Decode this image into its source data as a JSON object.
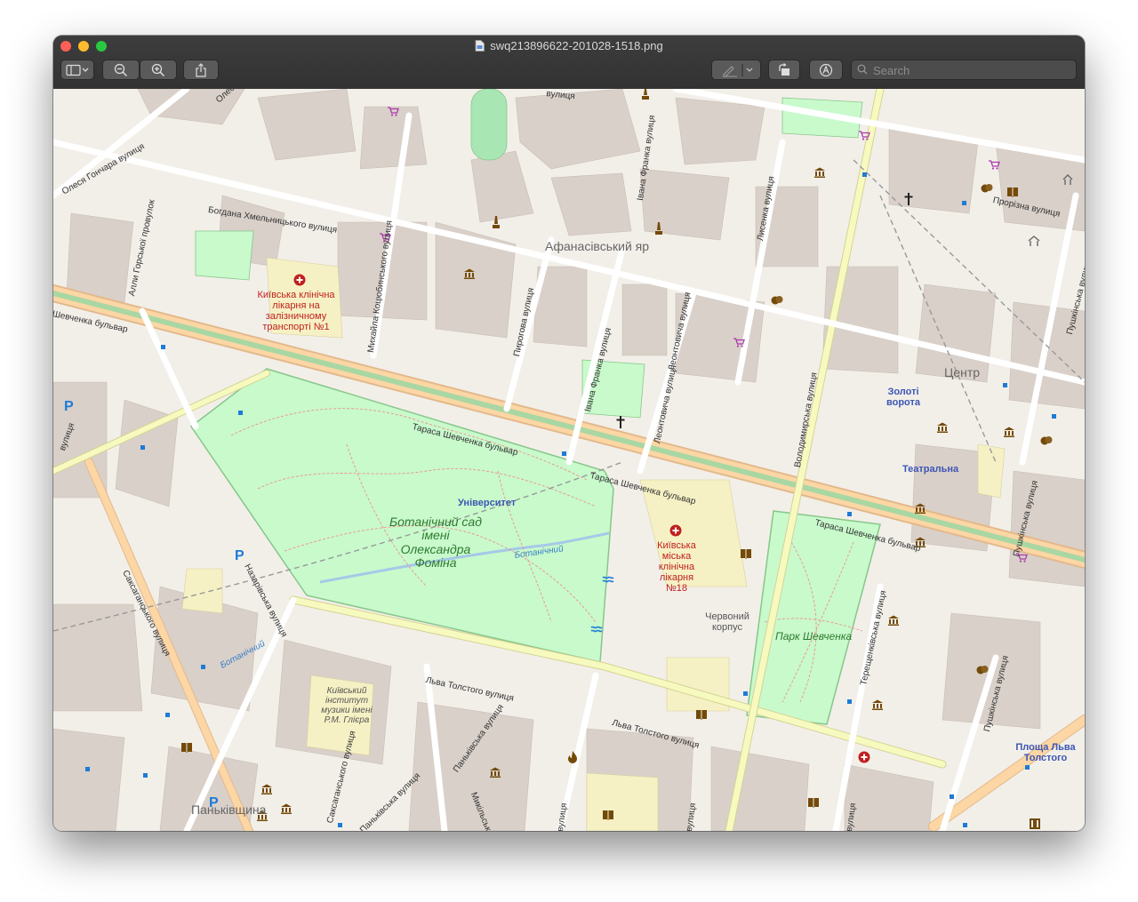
{
  "window": {
    "title": "swq213896622-201028-1518.png"
  },
  "toolbar": {
    "sidebar_button": "sidebar-icon",
    "zoom_out_button": "zoom-out-icon",
    "zoom_in_button": "zoom-in-icon",
    "share_button": "share-icon",
    "markup_button": "pen-icon",
    "rotate_button": "rotate-icon",
    "annotate_button": "annotate-icon",
    "search_placeholder": "Search"
  },
  "map": {
    "streets": {
      "oles_honchara": "Олеся Гончара вулиця",
      "bohdana_khmelnytskoho": "Богдана Хмельницького вулиця",
      "oles_top": "Олеся",
      "street_top": "вулиця",
      "alla_horskoi": "Алли Горської провулок",
      "mykhaila_kotsiubynskoho": "Михайла Коцюбинського вулиця",
      "pyrohova": "Пирогова вулиця",
      "ivana_franka_1": "Івана Франка вулиця",
      "ivana_franka_2": "Івана Франка вулиця",
      "leontovycha_1": "Леонтовича вулиця",
      "leontovycha_2": "Леонтовича вулиця",
      "lysenka": "Лисенка вулиця",
      "volodymyrska": "Володимирська вулиця",
      "prorizna": "Прорізна вулиця",
      "pushkinska_1": "Пушкінська вулиця",
      "pushkinska_2": "Пушкінська вулиця",
      "pushkinska_3": "Пушкінська вулиця",
      "shevchenka_left": "Шевченка бульвар",
      "shevchenka_1": "Тараса Шевченка бульвар",
      "shevchenka_2": "Тараса Шевченка бульвар",
      "shevchenka_3": "Тараса Шевченка бульвар",
      "nazarivska": "Назарівська вулиця",
      "saksahanskoho_1": "Саксаганського вулиця",
      "saksahanskoho_2": "Саксаганського вулиця",
      "lva_tolstoho_1": "Льва Толстого вулиця",
      "lva_tolstoho_2": "Льва Толстого вулиця",
      "pankivska_1": "Паньківська вулиця",
      "pankivska_2": "Паньківська вулиця",
      "mykilsko_botanichna": "Микільсько-Ботанічна",
      "tereshchenkivska": "Терещенківська вулиця",
      "vulytsia_left": "вулиця",
      "vulytsia_bottom": "вулиця",
      "vulytsia_bottom2": "вулиця",
      "yaroslaviv_left": "вулиця"
    },
    "places": {
      "afanasivskyi": "Афанасівський яр",
      "tsentr": "Центр",
      "pankivshchyna": "Паньківщина",
      "botanical_garden": "Ботанічний сад імені Олександра Фоміна",
      "park_shevchenka": "Парк Шевченка",
      "chervonyi_korpus": "Червоний корпус",
      "music_institute": "Київський інститут музики імені Р.М. Глієра",
      "botanichnyi_water": "Ботанічний",
      "botanichnyi_water2": "Ботанічний"
    },
    "hospitals": {
      "railway": "Київська клінічна лікарня на залізничному транспорті №1",
      "city18": "Київська міська клінічна лікарня №18"
    },
    "metro": {
      "universytet": "Університет",
      "zoloti_vorota": "Золоті ворота",
      "teatralna": "Театральна",
      "ploshcha_lva_tolstoho": "Площа Льва Толстого"
    },
    "colors": {
      "background": "#f2efe9",
      "building": "#d9d0c9",
      "park": "#c8facc",
      "primary_road": "#fcd6a4",
      "secondary_road": "#f7fabf",
      "hospital": "#c0201f",
      "metro_label": "#3d55b3"
    }
  }
}
